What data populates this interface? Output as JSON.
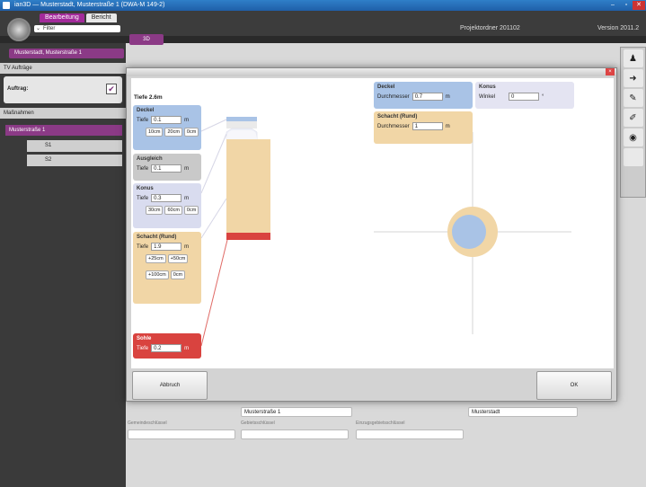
{
  "window": {
    "title": "ian3D — Musterstadt, Musterstraße 1 (DWA-M 149-2)",
    "min": "–",
    "max": "▫",
    "close": "✕"
  },
  "tabs": [
    {
      "label": "Bearbeitung"
    },
    {
      "label": "Bericht"
    }
  ],
  "filter": {
    "label": "Filter"
  },
  "projektordner": "Projektordner 201102",
  "version": "Version  2011.2",
  "tab3d": "3D",
  "sidebar": {
    "address": "Musterstadt, Musterstraße 1",
    "tv_auftraege": "TV Aufträge",
    "auftrag_label": "Auftrag:",
    "massnahmen": "Maßnahmen",
    "street": "Musterstraße 1",
    "items": [
      "S1",
      "S2"
    ]
  },
  "dialog": {
    "depth_label": "Tiefe 2.6m",
    "deckel": {
      "title": "Deckel",
      "tiefe_label": "Tiefe",
      "tiefe": "0.1",
      "unit": "m",
      "buttons": [
        "10cm",
        "20cm",
        "0cm"
      ]
    },
    "ausgleich": {
      "title": "Ausgleich",
      "tiefe_label": "Tiefe",
      "tiefe": "0.1",
      "unit": "m"
    },
    "konus": {
      "title": "Konus",
      "tiefe_label": "Tiefe",
      "tiefe": "0.3",
      "unit": "m",
      "buttons": [
        "30cm",
        "60cm",
        "0cm"
      ]
    },
    "schacht": {
      "title": "Schacht (Rund)",
      "tiefe_label": "Tiefe",
      "tiefe": "1.9",
      "unit": "m",
      "buttons": [
        "+25cm",
        "+50cm",
        "+100cm",
        "0cm"
      ]
    },
    "sohle": {
      "title": "Sohle",
      "tiefe_label": "Tiefe",
      "tiefe": "0.2",
      "unit": "m"
    },
    "deckel_top": {
      "title": "Deckel",
      "durchmesser_label": "Durchmesser",
      "durchmesser": "0.7",
      "unit": "m"
    },
    "schacht_top": {
      "title": "Schacht (Rund)",
      "durchmesser_label": "Durchmesser",
      "durchmesser": "1",
      "unit": "m"
    },
    "konus_top": {
      "title": "Konus",
      "winkel_label": "Winkel",
      "winkel": "0",
      "unit": "°"
    },
    "abbruch": "Abbruch",
    "ok": "OK"
  },
  "bottom_fields": {
    "street": "Musterstraße 1",
    "city": "Musterstadt",
    "labels": [
      "Gemeindeschlüssel",
      "Gebietsschlüssel",
      "Einzugsgebietsschlüssel"
    ]
  },
  "colors": {
    "purple": "#8b3a86",
    "blue": "#a9c3e6",
    "sand": "#f1d6a6",
    "red": "#d9433f",
    "grey": "#c9c9c9",
    "lavender": "#d9dcef"
  }
}
